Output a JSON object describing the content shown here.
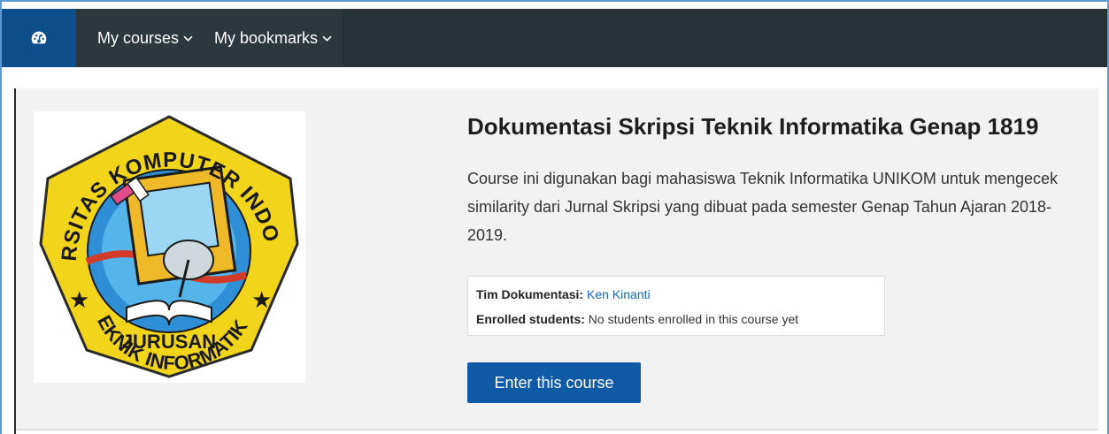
{
  "navbar": {
    "home_icon": "dashboard-gauge-icon",
    "items": [
      {
        "label": "My courses"
      },
      {
        "label": "My bookmarks"
      }
    ],
    "colors": {
      "bar": "#263238",
      "home": "#0f4e8c"
    }
  },
  "course": {
    "title": "Dokumentasi Skripsi Teknik Informatika Genap 1819",
    "summary": "Course ini digunakan bagi mahasiswa Teknik Informatika UNIKOM untuk mengecek similarity dari Jurnal Skripsi yang dibuat pada semester Genap Tahun Ajaran 2018-2019.",
    "contacts": {
      "role_label": "Tim Dokumentasi:",
      "name": "Ken Kinanti"
    },
    "enrolled": {
      "label": "Enrolled students:",
      "value": "No students enrolled in this course yet"
    },
    "enter_button": "Enter this course",
    "logo": {
      "top_text": "UNIVERSITAS KOMPUTER INDONESIA",
      "bottom_line1": "JURUSAN",
      "bottom_line2": "TEKNIK INFORMATIKA",
      "colors": {
        "outer": "#f2d51b",
        "inner": "#2f8fd6",
        "monitor": "#f0b92a",
        "text": "#1a1a1a"
      }
    }
  }
}
